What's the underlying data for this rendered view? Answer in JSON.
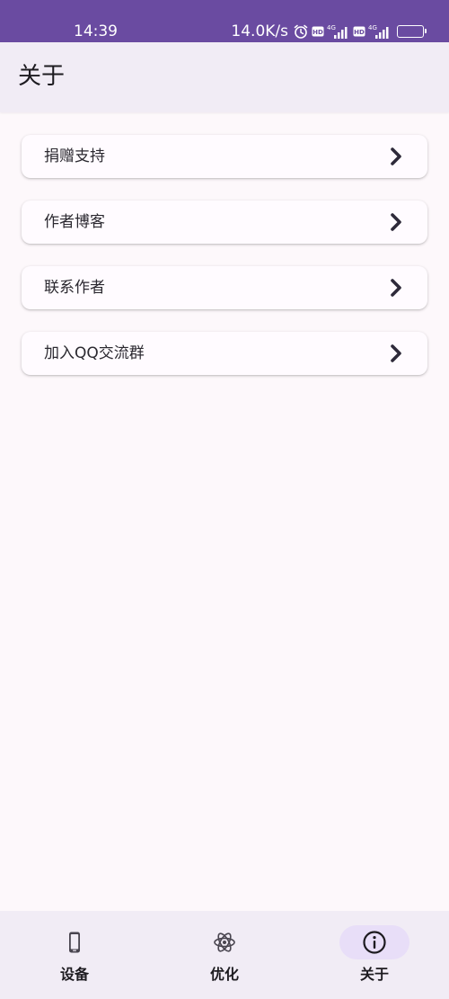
{
  "status_bar": {
    "time": "14:39",
    "net_speed": "14.0K/s",
    "icons": [
      "alarm-icon",
      "hd-icon",
      "signal-4g-icon",
      "hd-icon",
      "signal-4g-icon"
    ],
    "battery": "77",
    "battery_level": 0.77
  },
  "app_bar": {
    "title": "关于"
  },
  "menu": {
    "items": [
      {
        "label": "捐赠支持",
        "icon": "chevron-right-icon"
      },
      {
        "label": "作者博客",
        "icon": "chevron-right-icon"
      },
      {
        "label": "联系作者",
        "icon": "chevron-right-icon"
      },
      {
        "label": "加入QQ交流群",
        "icon": "chevron-right-icon"
      }
    ]
  },
  "bottom_nav": {
    "items": [
      {
        "label": "设备",
        "icon": "phone-device-icon",
        "active": false
      },
      {
        "label": "优化",
        "icon": "atom-icon",
        "active": false
      },
      {
        "label": "关于",
        "icon": "info-icon",
        "active": true
      }
    ]
  },
  "colors": {
    "status_bar": "#6a4ba1",
    "app_bar": "#f1ecf5",
    "background": "#fdf8fb",
    "active_indicator": "#e8def8",
    "chevron": "#2e2a3a"
  }
}
